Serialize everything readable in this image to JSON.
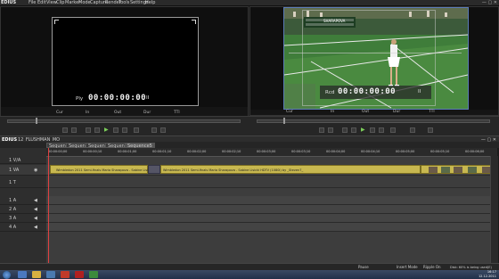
{
  "menubar": {
    "app_name": "EDIUS",
    "items": [
      "File",
      "Edit",
      "View",
      "Clip",
      "Marker",
      "Mode",
      "Capture",
      "Render",
      "Tools",
      "Settings",
      "Help"
    ]
  },
  "player": {
    "label": "Ply",
    "timecode": "00:00:00:00",
    "fields": [
      "Cur",
      "In",
      "Out",
      "Dur",
      "TTl"
    ]
  },
  "recorder": {
    "label": "Rcd",
    "timecode": "00:00:00:00",
    "scoreboard": "SHARAPOVA",
    "fields": [
      "Cur",
      "In",
      "Out",
      "Dur",
      "TTl"
    ]
  },
  "timeline": {
    "project": "12_FLUSHMAN_MO",
    "tabs": [
      "Sequence1",
      "Sequence2",
      "Sequence3",
      "Sequence4",
      "Sequence5"
    ],
    "tracks": [
      {
        "name": "1 V/A"
      },
      {
        "name": "1 VA"
      },
      {
        "name": "1 T"
      },
      {
        "name": "1 A"
      },
      {
        "name": "2 A"
      },
      {
        "name": "3 A"
      },
      {
        "name": "4 A"
      }
    ],
    "clips": [
      {
        "label": "Wimbledon 2011 Semi-finals Maria Sharapova - Sabine Lisicki"
      },
      {
        "label": "Wimbledon 2011 Semi-finals Maria Sharapova - Sabine Lisicki HDTV (1080i) by _Steven7_"
      }
    ],
    "ruler_ticks": [
      "00:00:00;00",
      "00:00:00;10",
      "00:00:01;00",
      "00:00:01;10",
      "00:00:02;00",
      "00:00:02;10",
      "00:00:03;00",
      "00:00:03;10",
      "00:00:04;00",
      "00:00:04;10",
      "00:00:05;00",
      "00:00:05;10",
      "00:00:06;00"
    ]
  },
  "status": {
    "items": [
      "Pause",
      "Insert Mode",
      "Ripple On",
      "Disk: 60% is being used(E)"
    ]
  },
  "taskbar": {
    "time": "16:17",
    "date": "12.12.2011"
  }
}
